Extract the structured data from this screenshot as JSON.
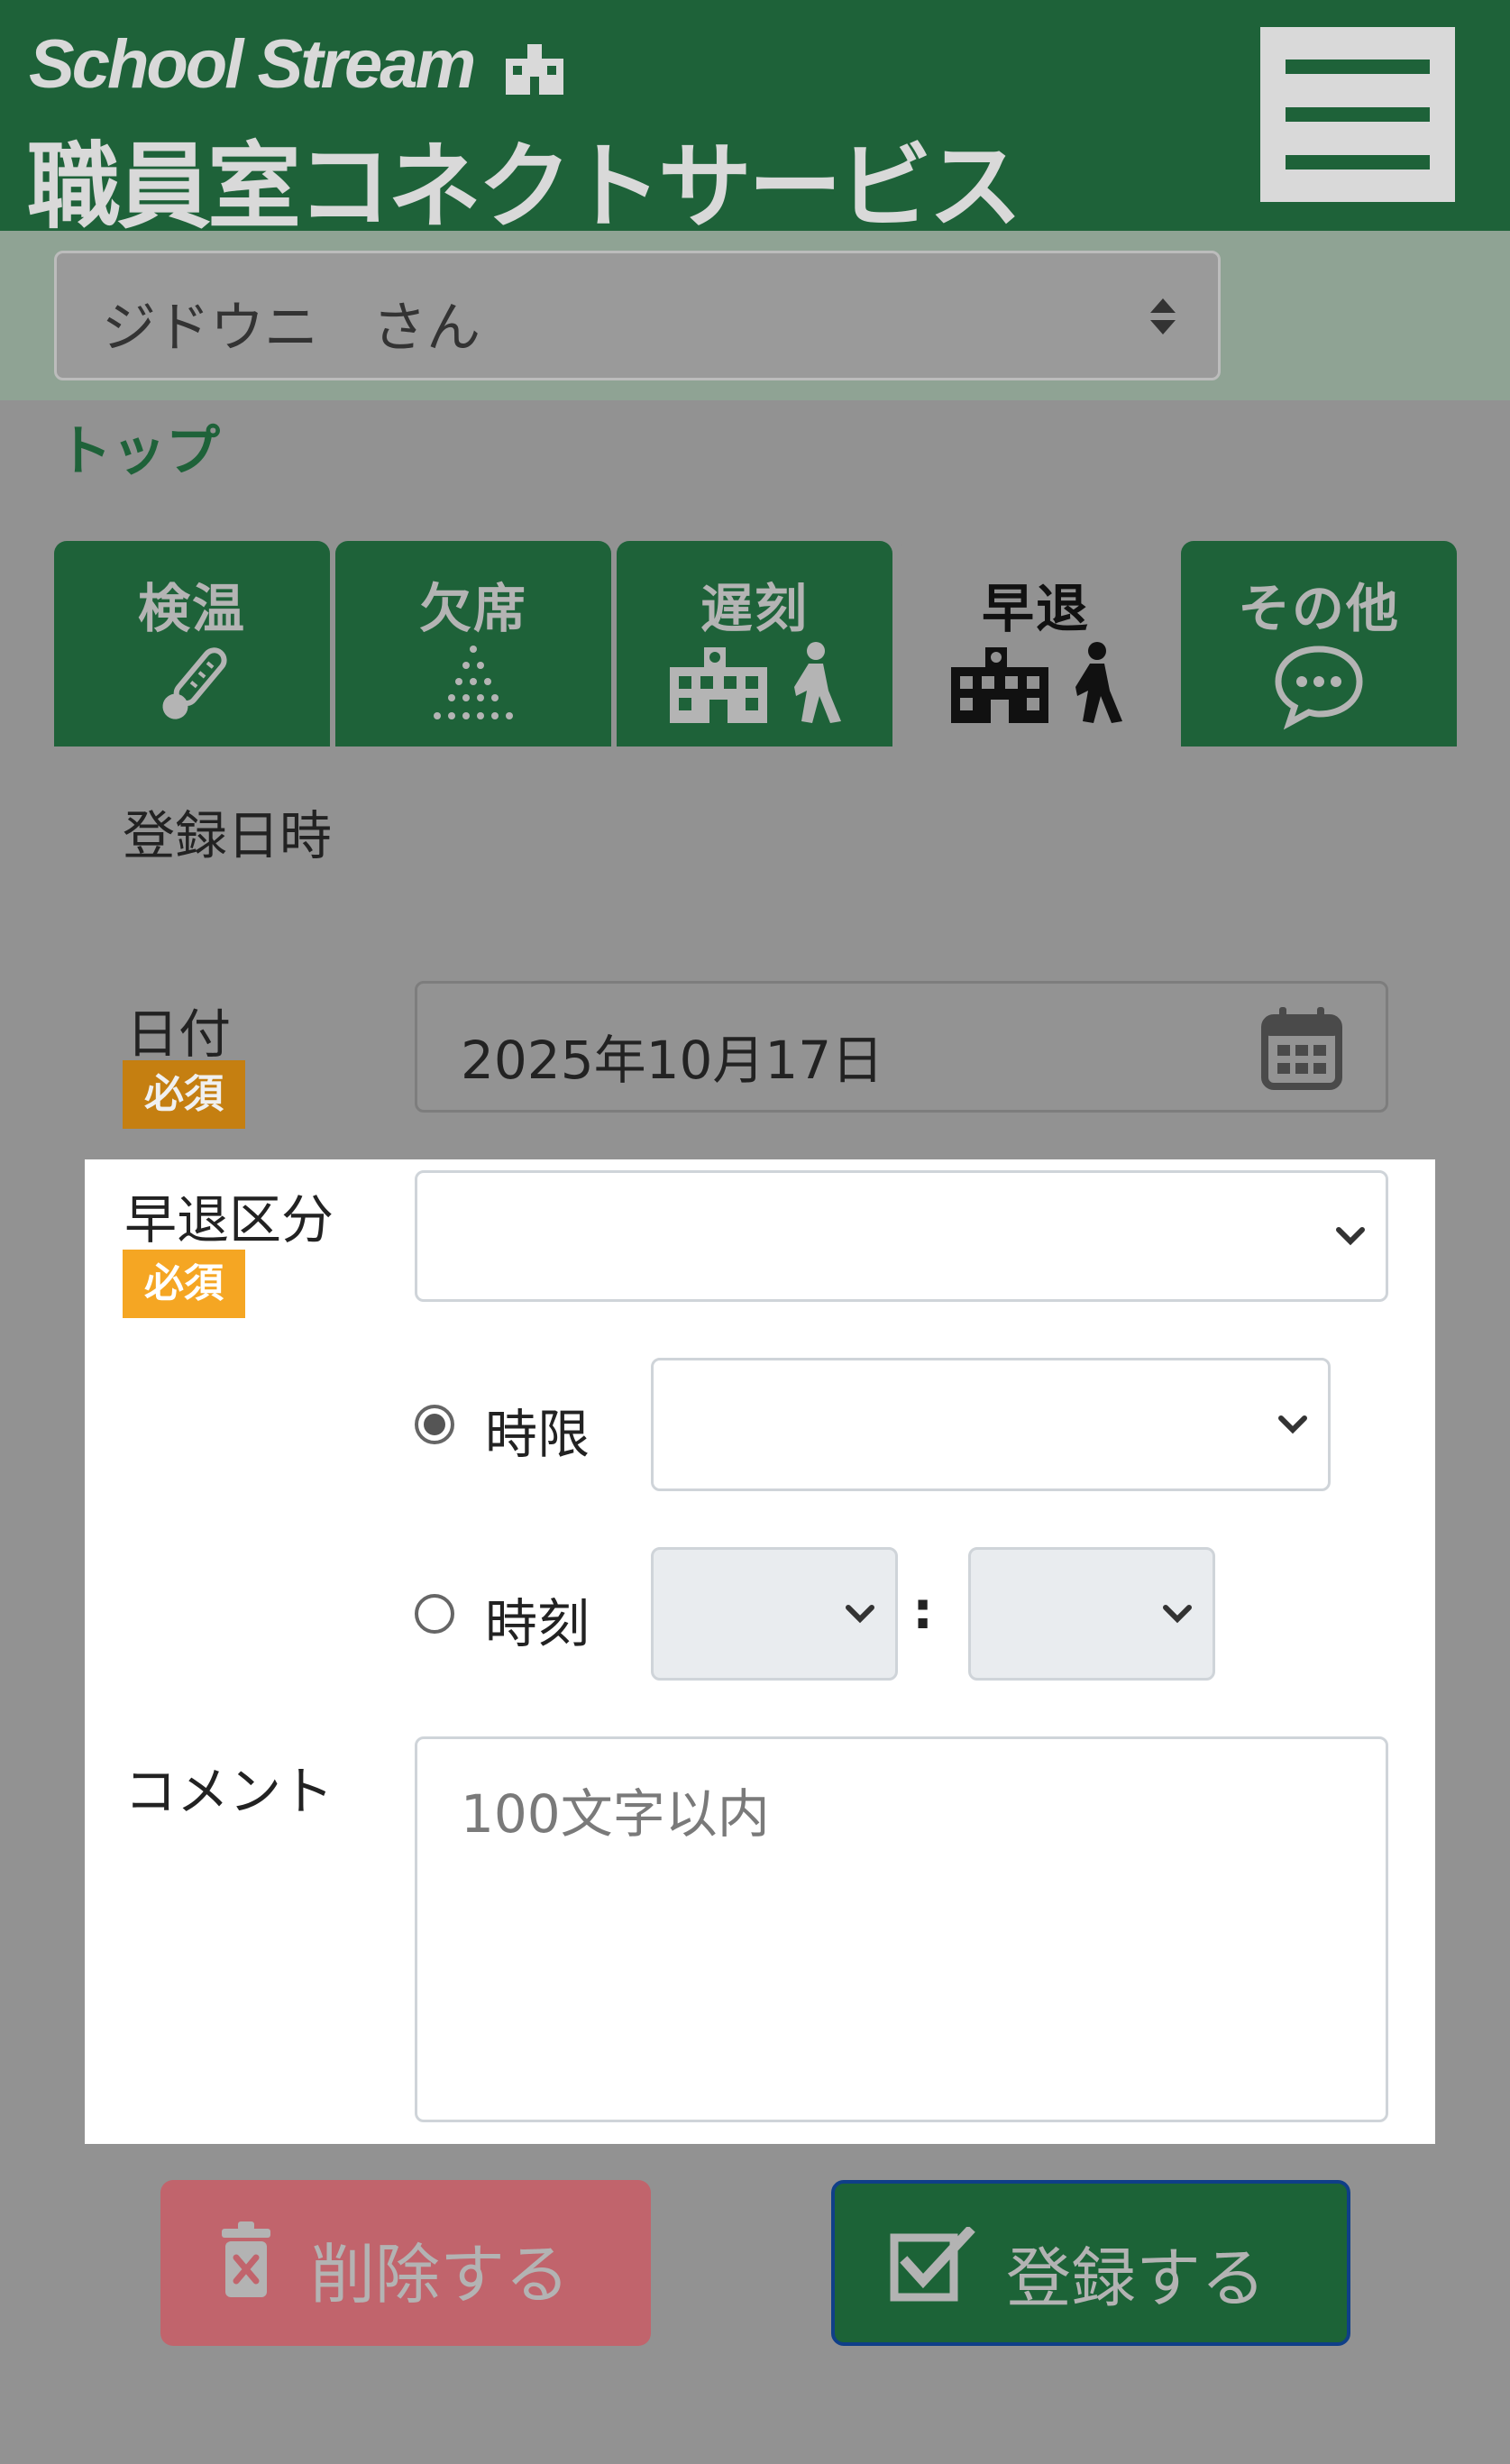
{
  "header": {
    "logo_text": "School Stream",
    "subtitle": "職員室コネクトサービス"
  },
  "user_select": {
    "value": "ジドウニ　さん"
  },
  "breadcrumb": "トップ",
  "tabs": [
    {
      "label": "検温",
      "icon": "thermometer-icon"
    },
    {
      "label": "欠席",
      "icon": "dots-triangle-icon"
    },
    {
      "label": "遅刻",
      "icon": "school-walker-icon"
    },
    {
      "label": "早退",
      "icon": "school-walker-icon",
      "active": true
    },
    {
      "label": "その他",
      "icon": "speech-bubble-icon"
    }
  ],
  "form": {
    "section_title": "登録日時",
    "date_label": "日付",
    "required": "必須",
    "date_value": "2025年10月17日",
    "category_label": "早退区分",
    "category_value": "",
    "radio_period_label": "時限",
    "radio_time_label": "時刻",
    "time_colon": ":",
    "comment_label": "コメント",
    "comment_placeholder": "100文字以内"
  },
  "buttons": {
    "delete_label": "削除する",
    "save_label": "登録する"
  },
  "colors": {
    "brand_green": "#1e6239",
    "required_badge": "#f5a623",
    "delete_red": "#c1646c"
  }
}
